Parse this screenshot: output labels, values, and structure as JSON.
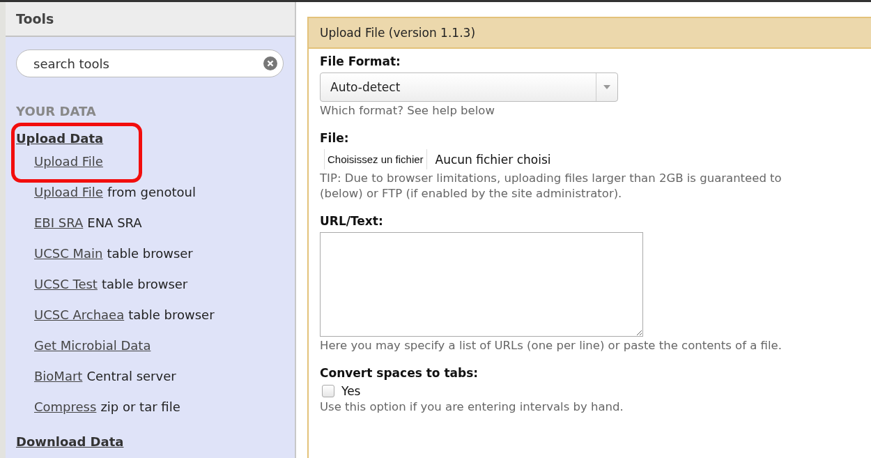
{
  "sidebar": {
    "title": "Tools",
    "search": {
      "placeholder": "search tools"
    },
    "section": "YOUR DATA",
    "groups": [
      {
        "label": "Upload Data",
        "highlighted": true,
        "items": [
          {
            "link": "Upload File"
          },
          {
            "link": "Upload File",
            "rest": "from genotoul"
          },
          {
            "link": "EBI SRA",
            "rest": "ENA SRA"
          },
          {
            "link": "UCSC Main",
            "rest": "table browser"
          },
          {
            "link": "UCSC Test",
            "rest": "table browser"
          },
          {
            "link": "UCSC Archaea",
            "rest": "table browser"
          },
          {
            "link": "Get Microbial Data"
          },
          {
            "link": "BioMart",
            "rest": "Central server"
          },
          {
            "link": "Compress",
            "rest": "zip or tar file"
          }
        ]
      },
      {
        "label": "Download Data",
        "highlighted": false
      }
    ]
  },
  "form": {
    "title": "Upload File (version 1.1.3)",
    "fields": [
      {
        "kind": "select",
        "label": "File Format:",
        "value": "Auto-detect",
        "help": "Which format? See help below"
      },
      {
        "kind": "file",
        "label": "File:",
        "button": "Choisissez un fichier",
        "status": "Aucun fichier choisi",
        "help": "TIP: Due to browser limitations, uploading files larger than 2GB is guaranteed to",
        "help2": "(below) or FTP (if enabled by the site administrator)."
      },
      {
        "kind": "textarea",
        "label": "URL/Text:",
        "help": "Here you may specify a list of URLs (one per line) or paste the contents of a file."
      },
      {
        "kind": "checkbox",
        "label": "Convert spaces to tabs:",
        "option": "Yes",
        "checked": false,
        "help": "Use this option if you are entering intervals by hand."
      }
    ]
  }
}
